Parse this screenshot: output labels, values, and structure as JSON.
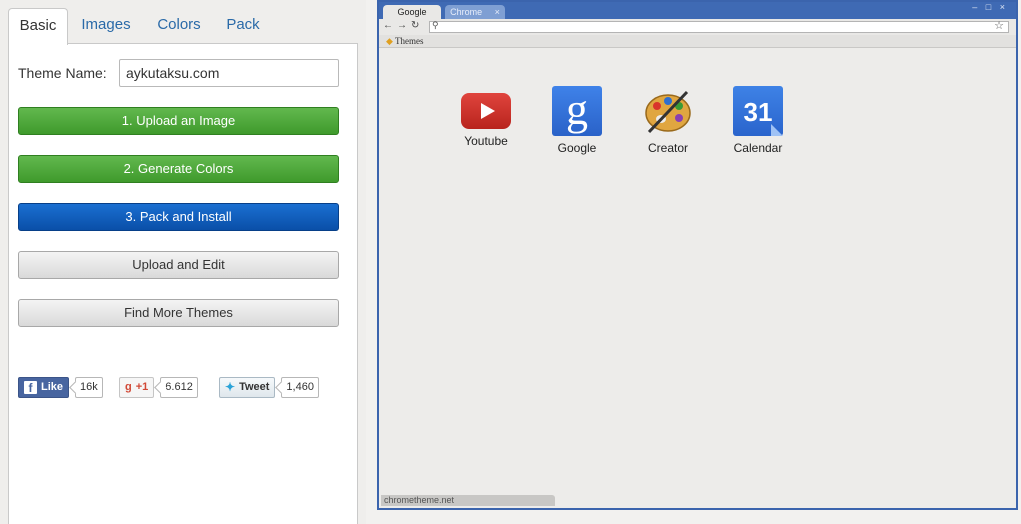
{
  "tabs": [
    "Basic",
    "Images",
    "Colors",
    "Pack"
  ],
  "theme": {
    "label": "Theme Name:",
    "value": "aykutaksu.com"
  },
  "buttons": {
    "upload_image": "1. Upload an Image",
    "generate_colors": "2. Generate Colors",
    "pack_install": "3. Pack and Install",
    "upload_edit": "Upload and Edit",
    "find_more": "Find More Themes"
  },
  "social": {
    "like": "Like",
    "like_count": "16k",
    "gplus": "+1",
    "gplus_count": "6.612",
    "tweet": "Tweet",
    "tweet_count": "1,460"
  },
  "browser": {
    "tabs": [
      "Google",
      "Chrome"
    ],
    "tab_close": "×",
    "window_controls": "– □ ×",
    "bookmark": "Themes",
    "status_url": "chrometheme.net",
    "apps": [
      "Youtube",
      "Google",
      "Creator",
      "Calendar"
    ],
    "calendar_day": "31"
  },
  "colors": {
    "green": "#4aa836",
    "blue": "#0a57b8",
    "frame": "#3f6ab4",
    "link": "#2a6aa8"
  }
}
